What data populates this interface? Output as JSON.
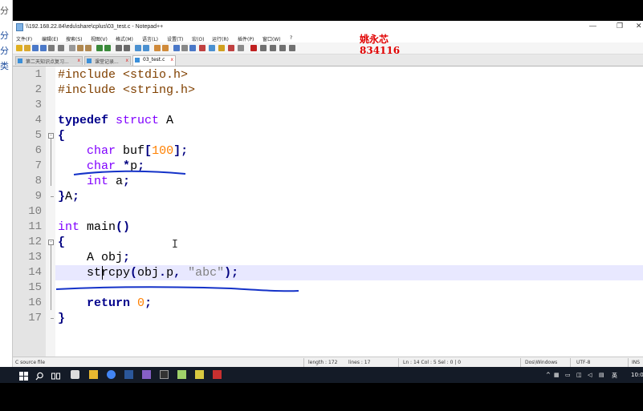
{
  "left_strip": [
    "分",
    "分",
    "分",
    "类"
  ],
  "window": {
    "title": "\\\\192.168.22.84\\edu\\share\\cplus\\03_test.c - Notepad++",
    "controls": {
      "minimize": "—",
      "maximize": "❐",
      "close": "✕"
    }
  },
  "watermark": {
    "name": "姚永芯",
    "id": "834116"
  },
  "menu": [
    "文件(F)",
    "编辑(E)",
    "搜索(S)",
    "视图(V)",
    "格式(M)",
    "语言(L)",
    "设置(T)",
    "宏(O)",
    "运行(R)",
    "插件(P)",
    "窗口(W)",
    "?"
  ],
  "tabs": [
    {
      "label": "第二天知识点复习...",
      "close": "x"
    },
    {
      "label": "课堂记录...",
      "close": "x"
    },
    {
      "label": "03_test.c",
      "close": "x"
    }
  ],
  "editor": {
    "line_numbers": [
      "1",
      "2",
      "3",
      "4",
      "5",
      "6",
      "7",
      "8",
      "9",
      "10",
      "11",
      "12",
      "13",
      "14",
      "15",
      "16",
      "17"
    ],
    "current_line": 14,
    "lines": [
      [
        {
          "t": "#include <stdio.h>",
          "c": "pp"
        }
      ],
      [
        {
          "t": "#include <string.h>",
          "c": "pp"
        }
      ],
      [],
      [
        {
          "t": "typedef",
          "c": "kw"
        },
        {
          "t": " "
        },
        {
          "t": "struct",
          "c": "ty"
        },
        {
          "t": " A"
        }
      ],
      [
        {
          "t": "{",
          "c": "op"
        }
      ],
      [
        {
          "t": "    "
        },
        {
          "t": "char",
          "c": "ty"
        },
        {
          "t": " buf"
        },
        {
          "t": "[",
          "c": "op"
        },
        {
          "t": "100",
          "c": "num"
        },
        {
          "t": "];",
          "c": "op"
        }
      ],
      [
        {
          "t": "    "
        },
        {
          "t": "char",
          "c": "ty"
        },
        {
          "t": " "
        },
        {
          "t": "*",
          "c": "op"
        },
        {
          "t": "p"
        },
        {
          "t": ";",
          "c": "op"
        }
      ],
      [
        {
          "t": "    "
        },
        {
          "t": "int",
          "c": "ty"
        },
        {
          "t": " a"
        },
        {
          "t": ";",
          "c": "op"
        }
      ],
      [
        {
          "t": "}",
          "c": "op"
        },
        {
          "t": "A"
        },
        {
          "t": ";",
          "c": "op"
        }
      ],
      [],
      [
        {
          "t": "int",
          "c": "ty"
        },
        {
          "t": " main"
        },
        {
          "t": "()",
          "c": "op"
        }
      ],
      [
        {
          "t": "{",
          "c": "op"
        }
      ],
      [
        {
          "t": "    A obj"
        },
        {
          "t": ";",
          "c": "op"
        }
      ],
      [
        {
          "t": "    strcpy"
        },
        {
          "t": "(",
          "c": "op"
        },
        {
          "t": "obj"
        },
        {
          "t": ".",
          "c": "op"
        },
        {
          "t": "p"
        },
        {
          "t": ",",
          "c": "op"
        },
        {
          "t": " "
        },
        {
          "t": "\"abc\"",
          "c": "str"
        },
        {
          "t": ");",
          "c": "op"
        }
      ],
      [],
      [
        {
          "t": "    "
        },
        {
          "t": "return",
          "c": "kw"
        },
        {
          "t": " "
        },
        {
          "t": "0",
          "c": "num"
        },
        {
          "t": ";",
          "c": "op"
        }
      ],
      [
        {
          "t": "}",
          "c": "op"
        }
      ]
    ]
  },
  "status": {
    "type": "C source file",
    "length": "length : 172",
    "lines": "lines : 17",
    "position": "Ln : 14   Col : 5   Sel : 0 | 0",
    "eol": "Dos\\Windows",
    "encoding": "UTF-8",
    "mode": "INS"
  },
  "taskbar": {
    "ime": "英",
    "time": "10:0",
    "app_icons": [
      "start-icon",
      "search-icon",
      "task-view-icon",
      "app-icon",
      "file-explorer-icon",
      "chrome-icon",
      "word-icon",
      "visual-studio-icon",
      "terminal-icon",
      "notepadpp-icon",
      "app-icon",
      "app-icon"
    ]
  },
  "colors": {
    "annotation": "#1432c8",
    "watermark": "#e00000",
    "current_line": "#e8e8ff"
  }
}
